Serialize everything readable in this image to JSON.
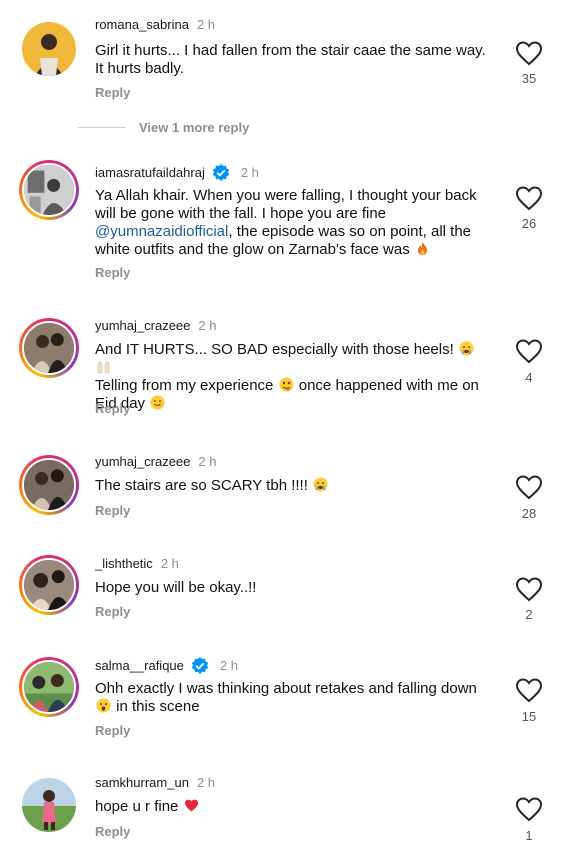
{
  "comments": [
    {
      "username": "romana_sabrina",
      "time": "2 h",
      "text": "Girl it hurts... I had fallen from the stair caae the same way. It hurts badly.",
      "reply_label": "Reply",
      "likes": "35",
      "more_replies": "View 1 more reply",
      "verified": false,
      "story_ring": false
    },
    {
      "username": "iamasratufaildahraj",
      "time": "2 h",
      "text_before": "Ya Allah khair. When you were falling, I thought your back will be gone with the fall. I hope you are fine ",
      "mention": "@yumnazaidiofficial",
      "text_after": ", the episode was so on point, all the white outfits and the glow on Zarnab's face was",
      "reply_label": "Reply",
      "likes": "26",
      "verified": true,
      "story_ring": true,
      "emoji": [
        "fire-icon"
      ]
    },
    {
      "username": "yumhaj_crazeee",
      "time": "2 h",
      "text_1": "And IT HURTS... SO BAD especially with those heels!",
      "text_2": "Telling from my experience",
      "text_3": "once happened with me on Eid day",
      "reply_label": "Reply",
      "likes": "4",
      "verified": false,
      "story_ring": true,
      "emoji": [
        "crying-face-icon",
        "raised-hands-icon",
        "zany-face-icon",
        "smiling-face-icon"
      ]
    },
    {
      "username": "yumhaj_crazeee",
      "time": "2 h",
      "text": "The stairs are so SCARY tbh !!!!",
      "reply_label": "Reply",
      "likes": "28",
      "verified": false,
      "story_ring": true,
      "emoji": [
        "crying-face-icon"
      ]
    },
    {
      "username": "_lishthetic",
      "time": "2 h",
      "text": "Hope you will be okay..!!",
      "reply_label": "Reply",
      "likes": "2",
      "verified": false,
      "story_ring": true
    },
    {
      "username": "salma__rafique",
      "time": "2 h",
      "text_1": "Ohh exactly I was thinking about retakes and falling down",
      "text_2": "in this scene",
      "reply_label": "Reply",
      "likes": "15",
      "verified": true,
      "story_ring": true,
      "emoji": [
        "surprised-face-icon"
      ]
    },
    {
      "username": "samkhurram_un",
      "time": "2 h",
      "text": "hope u r fine",
      "reply_label": "Reply",
      "likes": "1",
      "verified": false,
      "story_ring": false,
      "emoji": [
        "red-heart-icon"
      ]
    }
  ],
  "colors": {
    "username": "#1a1a1a",
    "meta_gray": "#8e8e8e",
    "mention": "#1e5aa8",
    "verified_blue": "#0095f6"
  }
}
